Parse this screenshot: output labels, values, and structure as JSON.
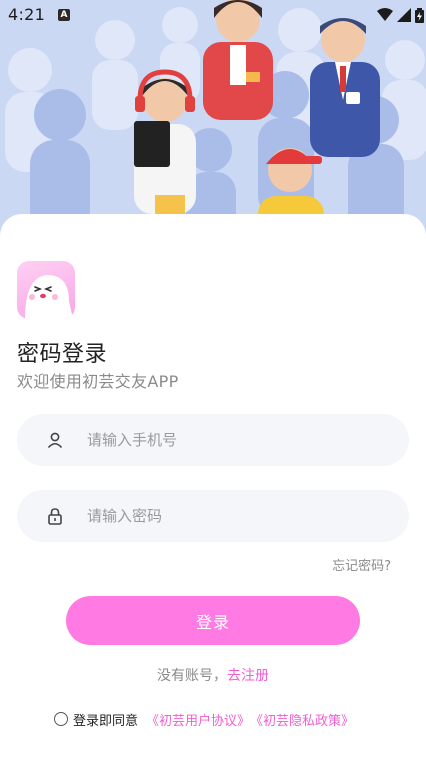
{
  "status_bar": {
    "time": "4:21",
    "notification_icon": "A"
  },
  "hero": {
    "illustration": "crowd-of-people-illustration"
  },
  "logo": {
    "icon": "ghost-mascot-icon",
    "color": "#f7a6e6"
  },
  "title": "密码登录",
  "subtitle": "欢迎使用初芸交友APP",
  "phone_field": {
    "placeholder": "请输入手机号",
    "value": "",
    "icon": "user-icon"
  },
  "password_field": {
    "placeholder": "请输入密码",
    "value": "",
    "icon": "lock-icon"
  },
  "forgot_password": "忘记密码?",
  "login_button": "登录",
  "register": {
    "prompt": "没有账号，",
    "link": "去注册"
  },
  "agreement": {
    "text": "登录即同意",
    "user_agreement": "《初芸用户协议》",
    "privacy_policy": "《初芸隐私政策》",
    "checked": false
  },
  "colors": {
    "accent": "#ff7be3",
    "link": "#f15ed2",
    "field_bg": "#f4f6f9"
  }
}
